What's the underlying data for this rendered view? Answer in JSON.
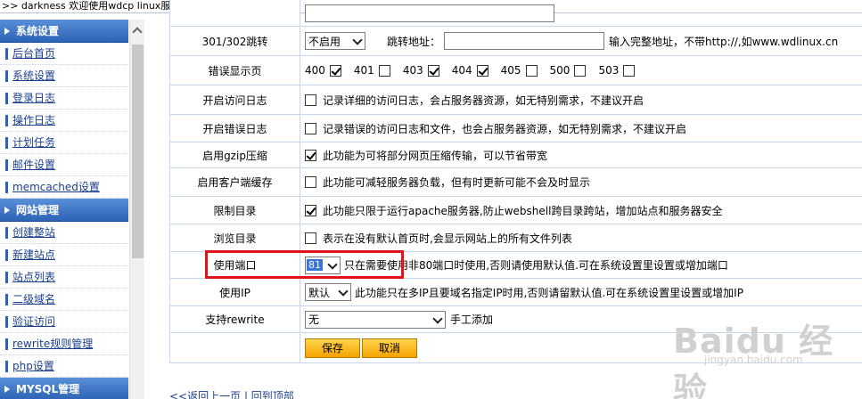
{
  "window": {
    "title": ">> darkness 欢迎使用wdcp linux服务器/虚拟主机管理系统"
  },
  "sidebar": {
    "section1": {
      "title": "系统设置"
    },
    "section1_items": [
      {
        "label": "后台首页"
      },
      {
        "label": "系统设置"
      },
      {
        "label": "登录日志"
      },
      {
        "label": "操作日志"
      },
      {
        "label": "计划任务"
      },
      {
        "label": "邮件设置"
      },
      {
        "label": "memcached设置"
      }
    ],
    "section2": {
      "title": "网站管理"
    },
    "section2_items": [
      {
        "label": "创建整站"
      },
      {
        "label": "新建站点"
      },
      {
        "label": "站点列表"
      },
      {
        "label": "二级域名"
      },
      {
        "label": "验证访问"
      },
      {
        "label": "rewrite规则管理"
      },
      {
        "label": "php设置"
      }
    ],
    "section3": {
      "title": "MYSQL管理"
    }
  },
  "form": {
    "redirect": {
      "label": "301/302跳转",
      "select_value": "不启用",
      "jump_label": "跳转地址：",
      "hint": "输入完整地址，不带http://,如www.wdlinux.cn"
    },
    "error_page": {
      "label": "错误显示页",
      "codes": [
        {
          "code": "400",
          "checked": true
        },
        {
          "code": "401",
          "checked": false
        },
        {
          "code": "403",
          "checked": true
        },
        {
          "code": "404",
          "checked": true
        },
        {
          "code": "405",
          "checked": false
        },
        {
          "code": "500",
          "checked": false
        },
        {
          "code": "503",
          "checked": false
        }
      ]
    },
    "access_log": {
      "label": "开启访问日志",
      "checked": false,
      "desc": "记录详细的访问日志，会占服务器资源，如无特别需求，不建议开启"
    },
    "error_log": {
      "label": "开启错误日志",
      "checked": false,
      "desc": "记录错误的访问日志和文件，也会占服务器资源，如无特别需求，不建议开启"
    },
    "gzip": {
      "label": "启用gzip压缩",
      "checked": true,
      "desc": "此功能为可将部分网页压缩传输，可以节省带宽"
    },
    "client_cache": {
      "label": "启用客户端缓存",
      "checked": false,
      "desc": "此功能可减轻服务器负载，但有时更新可能不会及时显示"
    },
    "restrict_dir": {
      "label": "限制目录",
      "checked": true,
      "desc": "此功能只限于运行apache服务器,防止webshell跨目录跨站，增加站点和服务器安全"
    },
    "browse_dir": {
      "label": "浏览目录",
      "checked": false,
      "desc": "表示在没有默认首页时,会显示网站上的所有文件列表"
    },
    "port": {
      "label": "使用端口",
      "select_value": "81",
      "desc": "只在需要使用非80端口时使用,否则请使用默认值.可在系统设置里设置或增加端口"
    },
    "ip": {
      "label": "使用IP",
      "select_value": "默认",
      "desc": "此功能只在多IP且要域名指定IP时用,否则请留默认值.可在系统设置里设置或增加IP"
    },
    "rewrite": {
      "label": "支持rewrite",
      "select_value": "无",
      "hint": "手工添加"
    },
    "buttons": {
      "save": "保存",
      "cancel": "取消"
    }
  },
  "footer": {
    "back": "<<返回上一页",
    "sep": " | ",
    "top": "回到顶部"
  },
  "watermark": {
    "brand": "Baidu 经验",
    "url": "jingyan.baidu.com"
  },
  "colors": {
    "sidebar_header": "#2d63b5",
    "link": "#1a3f8c",
    "highlight": "#e0121a",
    "button": "#f5a300"
  }
}
